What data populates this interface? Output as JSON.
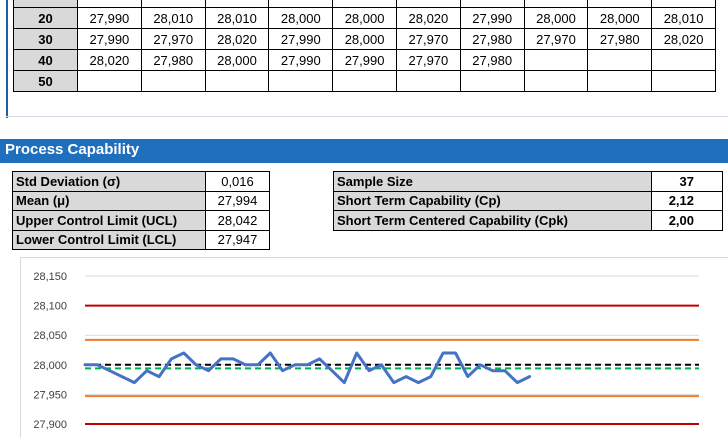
{
  "grid": {
    "rows": [
      {
        "label": "20",
        "values": [
          "27,990",
          "28,010",
          "28,010",
          "28,000",
          "28,000",
          "28,020",
          "27,990",
          "28,000",
          "28,000",
          "28,010"
        ]
      },
      {
        "label": "30",
        "values": [
          "27,990",
          "27,970",
          "28,020",
          "27,990",
          "28,000",
          "27,970",
          "27,980",
          "27,970",
          "27,980",
          "28,020"
        ]
      },
      {
        "label": "40",
        "values": [
          "28,020",
          "27,980",
          "28,000",
          "27,990",
          "27,990",
          "27,970",
          "27,980",
          "",
          "",
          ""
        ]
      },
      {
        "label": "50",
        "values": [
          "",
          "",
          "",
          "",
          "",
          "",
          "",
          "",
          "",
          ""
        ]
      }
    ]
  },
  "section_title": "Process Capability",
  "stats_left": [
    {
      "label": "Std Deviation (σ)",
      "value": "0,016"
    },
    {
      "label": "Mean (μ)",
      "value": "27,994"
    },
    {
      "label": "Upper Control Limit (UCL)",
      "value": "28,042"
    },
    {
      "label": "Lower Control Limit (LCL)",
      "value": "27,947"
    }
  ],
  "stats_right": [
    {
      "label": "Sample Size",
      "value": "37"
    },
    {
      "label": "Short Term Capability (Cp)",
      "value": "2,12"
    },
    {
      "label": "Short Term Centered Capability (Cpk)",
      "value": "2,00"
    }
  ],
  "chart_data": {
    "type": "line",
    "y_ticks": [
      "28,150",
      "28,100",
      "28,050",
      "28,000",
      "27,950",
      "27,900"
    ],
    "ylim": [
      27.9,
      28.15
    ],
    "grid": true,
    "series": [
      {
        "values": [
          28.0,
          28.0,
          27.99,
          27.98,
          27.97,
          27.99,
          27.98,
          28.01,
          28.02,
          28.0,
          27.99,
          28.01,
          28.01,
          28.0,
          28.0,
          28.02,
          27.99,
          28.0,
          28.0,
          28.01,
          27.99,
          27.97,
          28.02,
          27.99,
          28.0,
          27.97,
          27.98,
          27.97,
          27.98,
          28.02,
          28.02,
          27.98,
          28.0,
          27.99,
          27.99,
          27.97,
          27.98
        ],
        "color": "#4472c4"
      },
      {
        "values": [
          28.1
        ],
        "kind": "hline",
        "color": "#c00000"
      },
      {
        "values": [
          28.042
        ],
        "kind": "hline",
        "color": "#ed7d31"
      },
      {
        "values": [
          28.0
        ],
        "kind": "hline-dashed",
        "color": "#000000"
      },
      {
        "values": [
          27.994
        ],
        "kind": "hline-dashed",
        "color": "#00b050"
      },
      {
        "values": [
          27.947
        ],
        "kind": "hline",
        "color": "#ed7d31"
      },
      {
        "values": [
          27.9
        ],
        "kind": "hline",
        "color": "#c00000"
      }
    ]
  }
}
